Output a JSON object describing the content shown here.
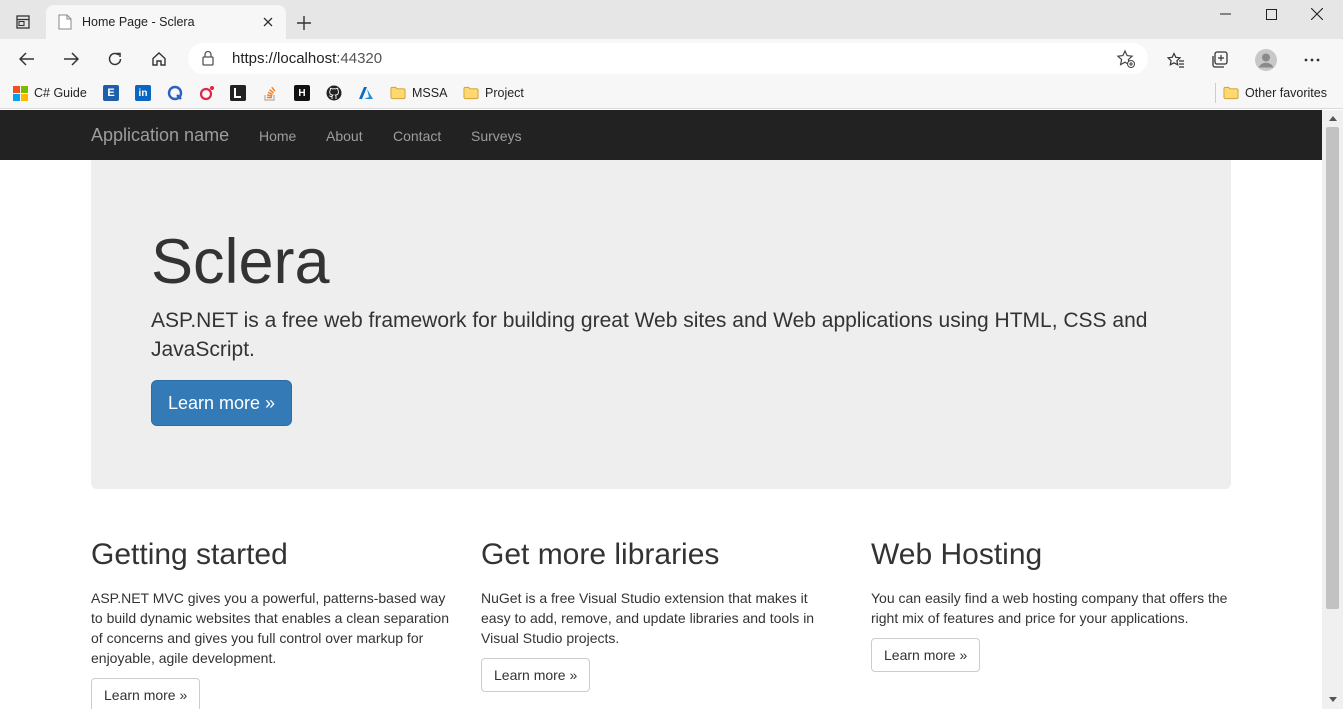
{
  "browser": {
    "tab_title": "Home Page - Sclera",
    "url_scheme": "https://",
    "url_host": "localhost",
    "url_port": ":44320",
    "bookmarks": [
      {
        "label": "C# Guide",
        "icon": "microsoft-icon"
      },
      {
        "label": "",
        "icon": "bookmark-e-icon"
      },
      {
        "label": "",
        "icon": "linkedin-icon"
      },
      {
        "label": "",
        "icon": "bookmark-q-icon"
      },
      {
        "label": "",
        "icon": "bookmark-red-icon"
      },
      {
        "label": "",
        "icon": "bookmark-dark-icon"
      },
      {
        "label": "",
        "icon": "stackoverflow-icon"
      },
      {
        "label": "",
        "icon": "bookmark-h-icon"
      },
      {
        "label": "",
        "icon": "github-icon"
      },
      {
        "label": "",
        "icon": "azure-icon"
      },
      {
        "label": "MSSA",
        "icon": "folder-icon"
      },
      {
        "label": "Project",
        "icon": "folder-icon"
      }
    ],
    "other_favorites": "Other favorites"
  },
  "navbar": {
    "brand": "Application name",
    "links": [
      "Home",
      "About",
      "Contact",
      "Surveys"
    ]
  },
  "jumbotron": {
    "title": "Sclera",
    "lead": "ASP.NET is a free web framework for building great Web sites and Web applications using HTML, CSS and JavaScript.",
    "button": "Learn more »"
  },
  "columns": [
    {
      "title": "Getting started",
      "text": "ASP.NET MVC gives you a powerful, patterns-based way to build dynamic websites that enables a clean separation of concerns and gives you full control over markup for enjoyable, agile development.",
      "button": "Learn more »"
    },
    {
      "title": "Get more libraries",
      "text": "NuGet is a free Visual Studio extension that makes it easy to add, remove, and update libraries and tools in Visual Studio projects.",
      "button": "Learn more »"
    },
    {
      "title": "Web Hosting",
      "text": "You can easily find a web hosting company that offers the right mix of features and price for your applications.",
      "button": "Learn more »"
    }
  ],
  "colors": {
    "navbar_bg": "#222222",
    "jumbotron_bg": "#eeeeee",
    "primary": "#337ab7"
  }
}
